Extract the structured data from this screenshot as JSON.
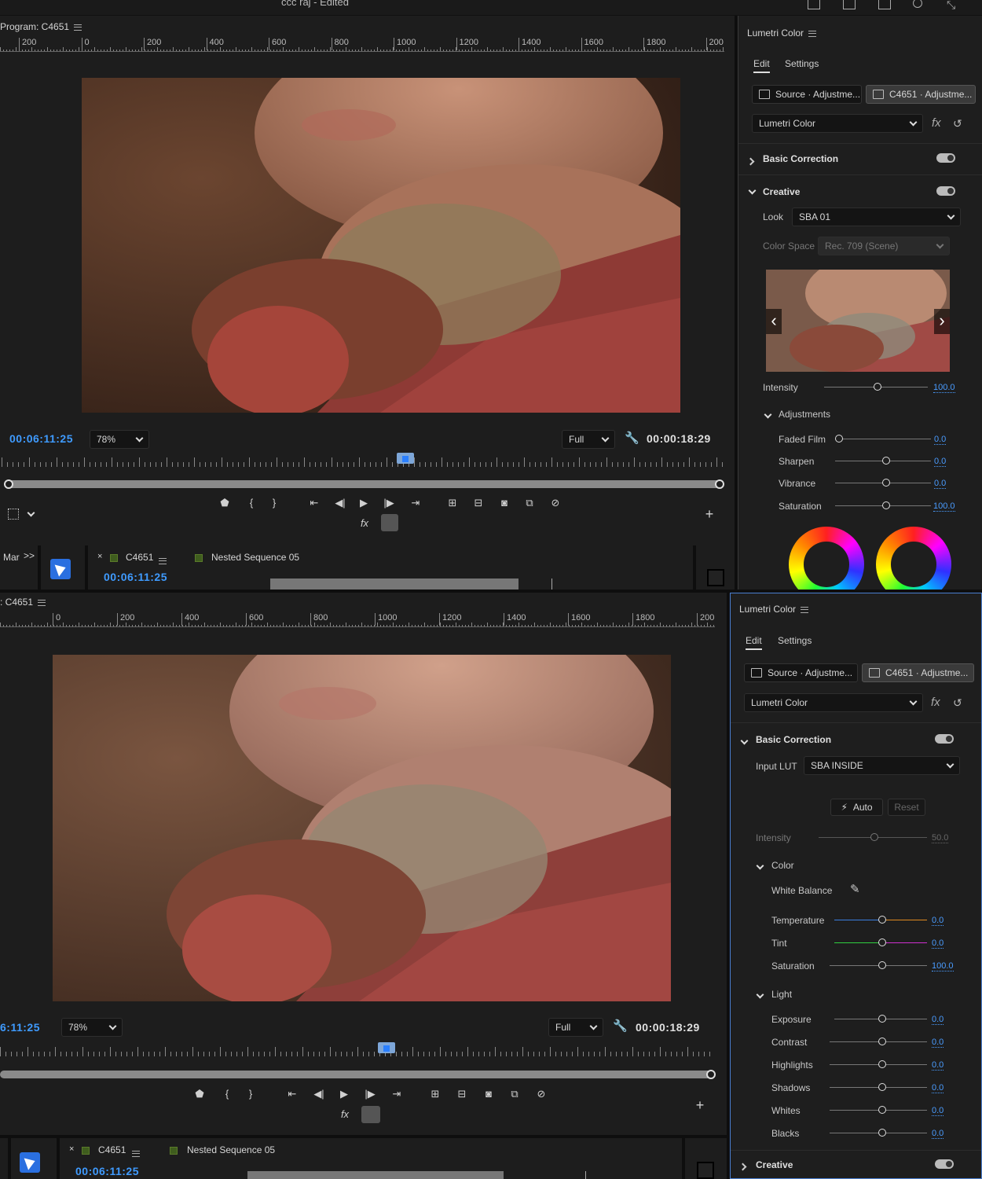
{
  "window": {
    "title": "ccc raj - Edited"
  },
  "top_monitor": {
    "title": "Program: C4651",
    "ruler_labels": [
      "200",
      "0",
      "200",
      "400",
      "600",
      "800",
      "1000",
      "1200",
      "1400",
      "1600",
      "1800",
      "200"
    ],
    "timecode_current": "00:06:11:25",
    "zoom": "78%",
    "quality": "Full",
    "timecode_duration": "00:00:18:29",
    "fx_label": "fx"
  },
  "top_lumetri": {
    "title": "Lumetri Color",
    "tabs": [
      "Edit",
      "Settings"
    ],
    "source_btn": "Source · Adjustme...",
    "clip_btn": "C4651 · Adjustme...",
    "effect_dropdown": "Lumetri Color",
    "fx_label": "fx",
    "basic_correction": "Basic Correction",
    "creative": "Creative",
    "look_label": "Look",
    "look_value": "SBA 01",
    "color_space_label": "Color Space",
    "color_space_value": "Rec. 709 (Scene)",
    "intensity_label": "Intensity",
    "intensity_value": "100.0",
    "adjustments": "Adjustments",
    "sliders": [
      {
        "label": "Faded Film",
        "value": "0.0"
      },
      {
        "label": "Sharpen",
        "value": "0.0"
      },
      {
        "label": "Vibrance",
        "value": "0.0"
      },
      {
        "label": "Saturation",
        "value": "100.0"
      }
    ]
  },
  "top_timeline": {
    "mar_label": "Mar",
    "more": ">>",
    "close": "×",
    "seq_tab": "C4651",
    "nested": "Nested Sequence 05",
    "timecode": "00:06:11:25"
  },
  "bottom_monitor": {
    "title": ": C4651",
    "ruler_labels": [
      "0",
      "200",
      "400",
      "600",
      "800",
      "1000",
      "1200",
      "1400",
      "1600",
      "1800",
      "200"
    ],
    "timecode_current": "6:11:25",
    "zoom": "78%",
    "quality": "Full",
    "timecode_duration": "00:00:18:29",
    "fx_label": "fx"
  },
  "bottom_lumetri": {
    "title": "Lumetri Color",
    "tabs": [
      "Edit",
      "Settings"
    ],
    "source_btn": "Source · Adjustme...",
    "clip_btn": "C4651 · Adjustme...",
    "effect_dropdown": "Lumetri Color",
    "fx_label": "fx",
    "basic_correction": "Basic Correction",
    "input_lut_label": "Input LUT",
    "input_lut_value": "SBA INSIDE",
    "auto_btn": "Auto",
    "reset_btn": "Reset",
    "intensity_label": "Intensity",
    "intensity_value": "50.0",
    "color_section": "Color",
    "white_balance": "White Balance",
    "color_sliders": [
      {
        "label": "Temperature",
        "value": "0.0"
      },
      {
        "label": "Tint",
        "value": "0.0"
      },
      {
        "label": "Saturation",
        "value": "100.0"
      }
    ],
    "light_section": "Light",
    "light_sliders": [
      {
        "label": "Exposure",
        "value": "0.0"
      },
      {
        "label": "Contrast",
        "value": "0.0"
      },
      {
        "label": "Highlights",
        "value": "0.0"
      },
      {
        "label": "Shadows",
        "value": "0.0"
      },
      {
        "label": "Whites",
        "value": "0.0"
      },
      {
        "label": "Blacks",
        "value": "0.0"
      }
    ],
    "creative": "Creative"
  },
  "bottom_timeline": {
    "close": "×",
    "seq_tab": "C4651",
    "nested": "Nested Sequence 05",
    "timecode": "00:06:11:25"
  },
  "colors": {
    "accent_blue": "#3f9bff",
    "tool_blue": "#2a6fe0",
    "panel_bg": "#1d1d1d"
  }
}
